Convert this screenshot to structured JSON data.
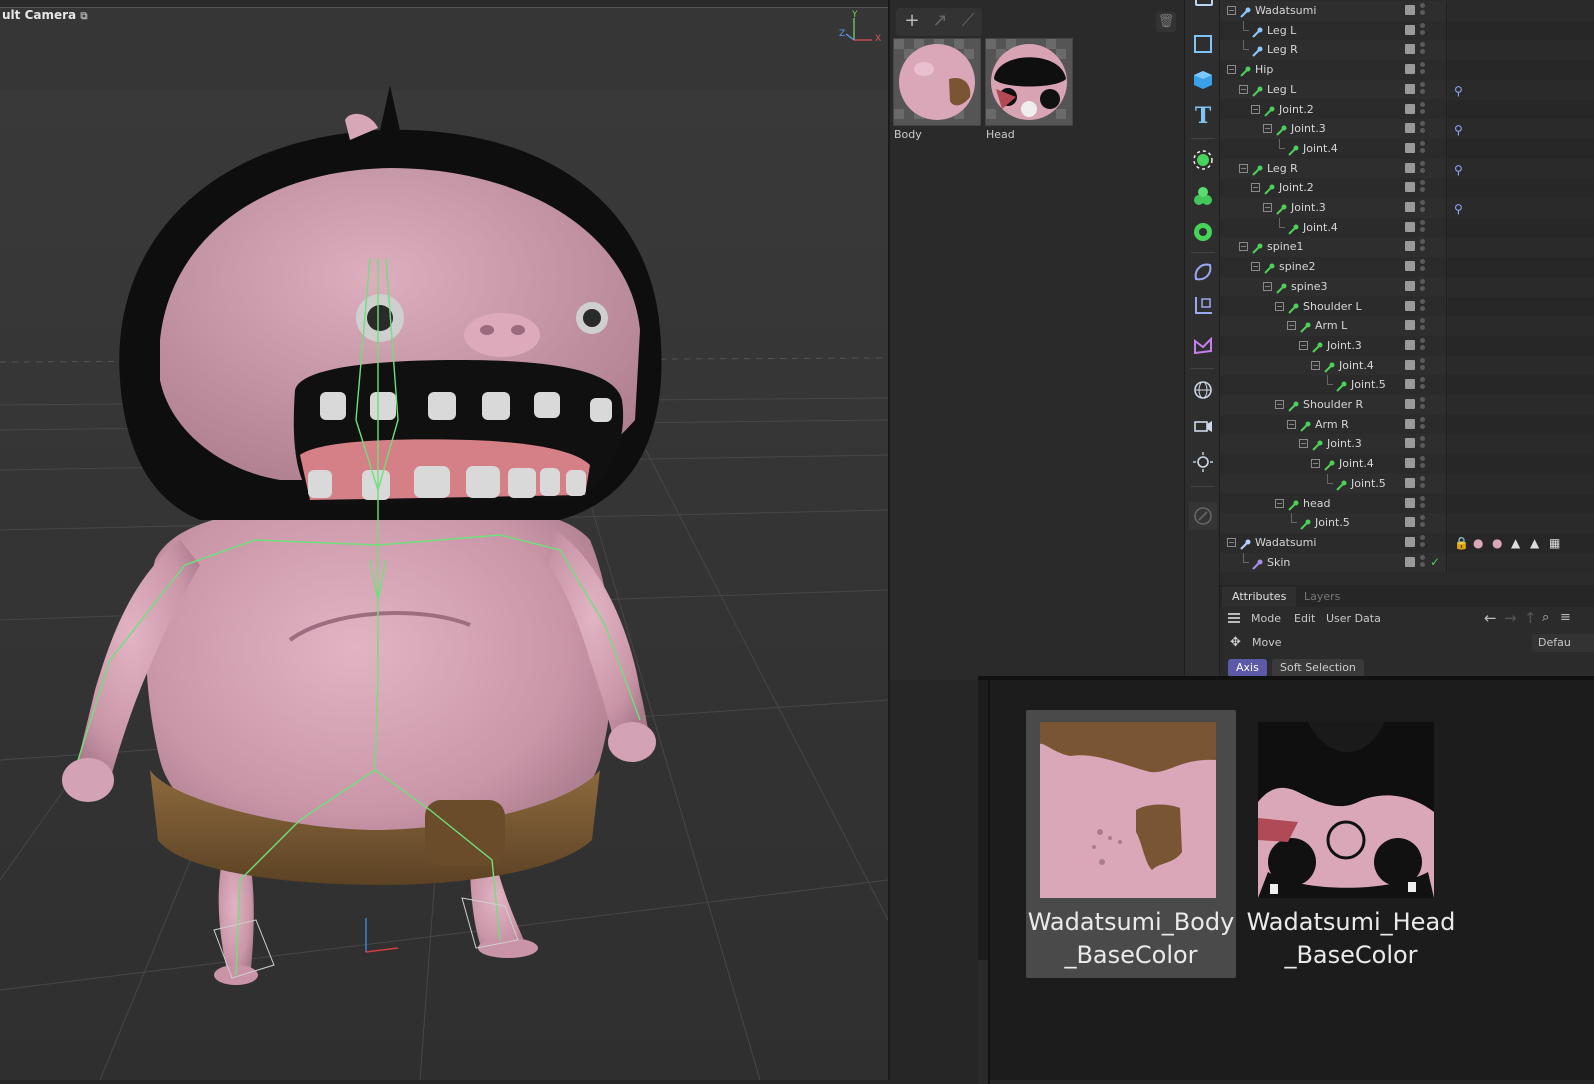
{
  "viewport": {
    "camera_label": "ult Camera",
    "axis_labels": {
      "y": "Y",
      "z": "Z",
      "x": "X"
    }
  },
  "material_manager": {
    "materials": [
      {
        "name": "Body"
      },
      {
        "name": "Head"
      }
    ]
  },
  "object_manager": {
    "rows": [
      {
        "label": "Wadatsumi",
        "type": "skeleton-root"
      },
      {
        "label": "Leg L",
        "type": "ik-null"
      },
      {
        "label": "Leg R",
        "type": "ik-null"
      },
      {
        "label": "Hip",
        "type": "joint"
      },
      {
        "label": "Leg L",
        "type": "joint"
      },
      {
        "label": "Joint.2",
        "type": "joint"
      },
      {
        "label": "Joint.3",
        "type": "joint"
      },
      {
        "label": "Joint.4",
        "type": "joint"
      },
      {
        "label": "Leg R",
        "type": "joint"
      },
      {
        "label": "Joint.2",
        "type": "joint"
      },
      {
        "label": "Joint.3",
        "type": "joint"
      },
      {
        "label": "Joint.4",
        "type": "joint"
      },
      {
        "label": "spine1",
        "type": "joint"
      },
      {
        "label": "spine2",
        "type": "joint"
      },
      {
        "label": "spine3",
        "type": "joint"
      },
      {
        "label": "Shoulder L",
        "type": "joint"
      },
      {
        "label": "Arm L",
        "type": "joint"
      },
      {
        "label": "Joint.3",
        "type": "joint"
      },
      {
        "label": "Joint.4",
        "type": "joint"
      },
      {
        "label": "Joint.5",
        "type": "joint"
      },
      {
        "label": "Shoulder R",
        "type": "joint"
      },
      {
        "label": "Arm R",
        "type": "joint"
      },
      {
        "label": "Joint.3",
        "type": "joint"
      },
      {
        "label": "Joint.4",
        "type": "joint"
      },
      {
        "label": "Joint.5",
        "type": "joint"
      },
      {
        "label": "head",
        "type": "joint"
      },
      {
        "label": "Joint.5",
        "type": "joint"
      },
      {
        "label": "Wadatsumi",
        "type": "mesh"
      },
      {
        "label": "Skin",
        "type": "skin-deformer"
      }
    ]
  },
  "attributes": {
    "tabs": [
      "Attributes",
      "Layers"
    ],
    "menu": [
      "Mode",
      "Edit",
      "User Data"
    ],
    "tool": "Move",
    "tool_preset": "Defau",
    "subtabs": [
      "Axis",
      "Soft Selection"
    ]
  },
  "picture_viewer": {
    "textures": [
      {
        "label_line1": "Wadatsumi_Body",
        "label_line2": "_BaseColor"
      },
      {
        "label_line1": "Wadatsumi_Head",
        "label_line2": "_BaseColor"
      }
    ]
  },
  "colors": {
    "accent": "#5a5aa8",
    "joint_green": "#4ecf5a",
    "skin_pink": "#d9a7b8",
    "belt_brown": "#7a5a34"
  }
}
